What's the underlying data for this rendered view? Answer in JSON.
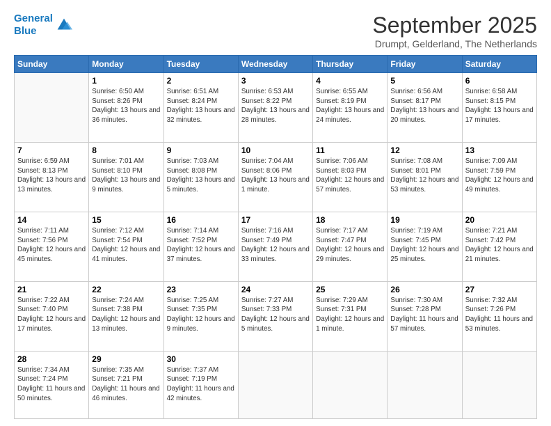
{
  "header": {
    "logo_line1": "General",
    "logo_line2": "Blue",
    "month": "September 2025",
    "location": "Drumpt, Gelderland, The Netherlands"
  },
  "weekdays": [
    "Sunday",
    "Monday",
    "Tuesday",
    "Wednesday",
    "Thursday",
    "Friday",
    "Saturday"
  ],
  "weeks": [
    [
      {
        "day": "",
        "sunrise": "",
        "sunset": "",
        "daylight": ""
      },
      {
        "day": "1",
        "sunrise": "Sunrise: 6:50 AM",
        "sunset": "Sunset: 8:26 PM",
        "daylight": "Daylight: 13 hours and 36 minutes."
      },
      {
        "day": "2",
        "sunrise": "Sunrise: 6:51 AM",
        "sunset": "Sunset: 8:24 PM",
        "daylight": "Daylight: 13 hours and 32 minutes."
      },
      {
        "day": "3",
        "sunrise": "Sunrise: 6:53 AM",
        "sunset": "Sunset: 8:22 PM",
        "daylight": "Daylight: 13 hours and 28 minutes."
      },
      {
        "day": "4",
        "sunrise": "Sunrise: 6:55 AM",
        "sunset": "Sunset: 8:19 PM",
        "daylight": "Daylight: 13 hours and 24 minutes."
      },
      {
        "day": "5",
        "sunrise": "Sunrise: 6:56 AM",
        "sunset": "Sunset: 8:17 PM",
        "daylight": "Daylight: 13 hours and 20 minutes."
      },
      {
        "day": "6",
        "sunrise": "Sunrise: 6:58 AM",
        "sunset": "Sunset: 8:15 PM",
        "daylight": "Daylight: 13 hours and 17 minutes."
      }
    ],
    [
      {
        "day": "7",
        "sunrise": "Sunrise: 6:59 AM",
        "sunset": "Sunset: 8:13 PM",
        "daylight": "Daylight: 13 hours and 13 minutes."
      },
      {
        "day": "8",
        "sunrise": "Sunrise: 7:01 AM",
        "sunset": "Sunset: 8:10 PM",
        "daylight": "Daylight: 13 hours and 9 minutes."
      },
      {
        "day": "9",
        "sunrise": "Sunrise: 7:03 AM",
        "sunset": "Sunset: 8:08 PM",
        "daylight": "Daylight: 13 hours and 5 minutes."
      },
      {
        "day": "10",
        "sunrise": "Sunrise: 7:04 AM",
        "sunset": "Sunset: 8:06 PM",
        "daylight": "Daylight: 13 hours and 1 minute."
      },
      {
        "day": "11",
        "sunrise": "Sunrise: 7:06 AM",
        "sunset": "Sunset: 8:03 PM",
        "daylight": "Daylight: 12 hours and 57 minutes."
      },
      {
        "day": "12",
        "sunrise": "Sunrise: 7:08 AM",
        "sunset": "Sunset: 8:01 PM",
        "daylight": "Daylight: 12 hours and 53 minutes."
      },
      {
        "day": "13",
        "sunrise": "Sunrise: 7:09 AM",
        "sunset": "Sunset: 7:59 PM",
        "daylight": "Daylight: 12 hours and 49 minutes."
      }
    ],
    [
      {
        "day": "14",
        "sunrise": "Sunrise: 7:11 AM",
        "sunset": "Sunset: 7:56 PM",
        "daylight": "Daylight: 12 hours and 45 minutes."
      },
      {
        "day": "15",
        "sunrise": "Sunrise: 7:12 AM",
        "sunset": "Sunset: 7:54 PM",
        "daylight": "Daylight: 12 hours and 41 minutes."
      },
      {
        "day": "16",
        "sunrise": "Sunrise: 7:14 AM",
        "sunset": "Sunset: 7:52 PM",
        "daylight": "Daylight: 12 hours and 37 minutes."
      },
      {
        "day": "17",
        "sunrise": "Sunrise: 7:16 AM",
        "sunset": "Sunset: 7:49 PM",
        "daylight": "Daylight: 12 hours and 33 minutes."
      },
      {
        "day": "18",
        "sunrise": "Sunrise: 7:17 AM",
        "sunset": "Sunset: 7:47 PM",
        "daylight": "Daylight: 12 hours and 29 minutes."
      },
      {
        "day": "19",
        "sunrise": "Sunrise: 7:19 AM",
        "sunset": "Sunset: 7:45 PM",
        "daylight": "Daylight: 12 hours and 25 minutes."
      },
      {
        "day": "20",
        "sunrise": "Sunrise: 7:21 AM",
        "sunset": "Sunset: 7:42 PM",
        "daylight": "Daylight: 12 hours and 21 minutes."
      }
    ],
    [
      {
        "day": "21",
        "sunrise": "Sunrise: 7:22 AM",
        "sunset": "Sunset: 7:40 PM",
        "daylight": "Daylight: 12 hours and 17 minutes."
      },
      {
        "day": "22",
        "sunrise": "Sunrise: 7:24 AM",
        "sunset": "Sunset: 7:38 PM",
        "daylight": "Daylight: 12 hours and 13 minutes."
      },
      {
        "day": "23",
        "sunrise": "Sunrise: 7:25 AM",
        "sunset": "Sunset: 7:35 PM",
        "daylight": "Daylight: 12 hours and 9 minutes."
      },
      {
        "day": "24",
        "sunrise": "Sunrise: 7:27 AM",
        "sunset": "Sunset: 7:33 PM",
        "daylight": "Daylight: 12 hours and 5 minutes."
      },
      {
        "day": "25",
        "sunrise": "Sunrise: 7:29 AM",
        "sunset": "Sunset: 7:31 PM",
        "daylight": "Daylight: 12 hours and 1 minute."
      },
      {
        "day": "26",
        "sunrise": "Sunrise: 7:30 AM",
        "sunset": "Sunset: 7:28 PM",
        "daylight": "Daylight: 11 hours and 57 minutes."
      },
      {
        "day": "27",
        "sunrise": "Sunrise: 7:32 AM",
        "sunset": "Sunset: 7:26 PM",
        "daylight": "Daylight: 11 hours and 53 minutes."
      }
    ],
    [
      {
        "day": "28",
        "sunrise": "Sunrise: 7:34 AM",
        "sunset": "Sunset: 7:24 PM",
        "daylight": "Daylight: 11 hours and 50 minutes."
      },
      {
        "day": "29",
        "sunrise": "Sunrise: 7:35 AM",
        "sunset": "Sunset: 7:21 PM",
        "daylight": "Daylight: 11 hours and 46 minutes."
      },
      {
        "day": "30",
        "sunrise": "Sunrise: 7:37 AM",
        "sunset": "Sunset: 7:19 PM",
        "daylight": "Daylight: 11 hours and 42 minutes."
      },
      {
        "day": "",
        "sunrise": "",
        "sunset": "",
        "daylight": ""
      },
      {
        "day": "",
        "sunrise": "",
        "sunset": "",
        "daylight": ""
      },
      {
        "day": "",
        "sunrise": "",
        "sunset": "",
        "daylight": ""
      },
      {
        "day": "",
        "sunrise": "",
        "sunset": "",
        "daylight": ""
      }
    ]
  ]
}
